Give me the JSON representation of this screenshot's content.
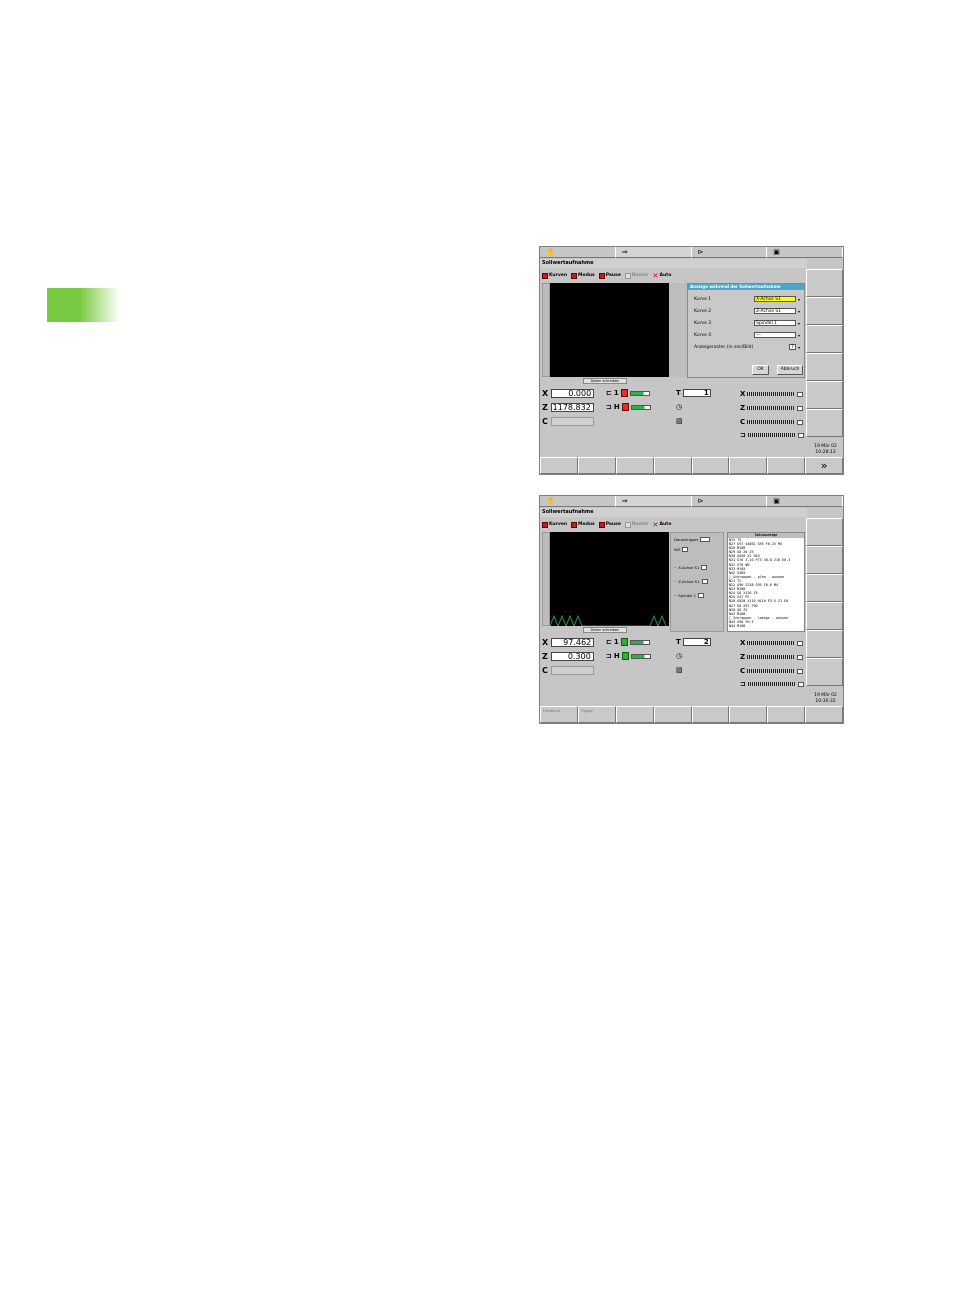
{
  "shots": [
    {
      "title": "Sollwertaufnahme",
      "menu": [
        "Kurven",
        "Modus",
        "Pause",
        "Raster",
        "Auto"
      ],
      "scope_label": "Daten schreiben",
      "dialog": {
        "title": "Anzeige während der Sollwertaufnahme",
        "rows": [
          {
            "label": "Kurve 1",
            "value": "X-Achse S1"
          },
          {
            "label": "Kurve 2",
            "value": "Z-Achse S1"
          },
          {
            "label": "Kurve 3",
            "value": "Spindel 1"
          },
          {
            "label": "Kurve 4",
            "value": "---"
          }
        ],
        "raster_label": "Anzeigeraster (in sec/Bild)",
        "raster_value": "7",
        "ok": "OK",
        "cancel": "Abbruch"
      },
      "pos": {
        "x": "0.000",
        "z": "1178.832"
      },
      "t_value": "1",
      "clock": {
        "date": "19 Mär 02",
        "time": "10:28:13"
      },
      "bottom": [
        "",
        "",
        "",
        "",
        "",
        "",
        "",
        ""
      ]
    },
    {
      "title": "Sollwertaufnahme",
      "menu": [
        "Kurven",
        "Modus",
        "Pause",
        "Raster",
        "Auto"
      ],
      "scope_label": "Daten schreiben",
      "mid": {
        "trigger": "Dauertrigger",
        "wz": "WZ",
        "c1": "X-Achse S1",
        "c2": "Z-Achse S1",
        "c3": "Spindel 1"
      },
      "prog_header": "Satzanzeige",
      "prog": [
        "N25 T2",
        "N27 G97 S4061 G95 F0.25 M4",
        "N28 M108",
        "N29 G0 X0 Z5",
        "N30 G0X0 X1 G63",
        "N31 G76 Z-10 P73 X0.8 Z10 E0.3",
        "N32 G76 W0",
        "N33 M105",
        "N42 G405",
        "[ Schruppen - plan - aussen",
        "N21 T2",
        "N22 G96 S238 G95 F0.6 M4",
        "N23 M108",
        "N24 G0 X126 Z5",
        "N25 G47 P2",
        "N26 G820 X110 H110 P3.5 Z1 E0",
        "N27 G0 X97.790",
        "N28 G0 Z5",
        "N42 M108",
        "[ Schruppen - laengs - aussen",
        "N43 G96 F0.3",
        "N44 M108"
      ],
      "pos": {
        "x": "97.462",
        "z": "0.300"
      },
      "t_value": "2",
      "clock": {
        "date": "19 Mär 02",
        "time": "10:30:32"
      },
      "bottom": [
        "Fensterlst",
        "Trigger",
        "",
        "",
        "",
        "",
        "",
        ""
      ]
    }
  ]
}
